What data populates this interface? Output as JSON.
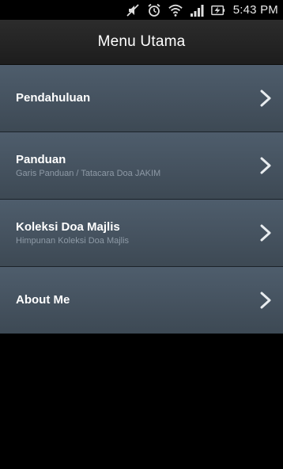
{
  "status_bar": {
    "time": "5:43 PM",
    "icons": [
      "mute-icon",
      "alarm-icon",
      "wifi-icon",
      "signal-icon",
      "battery-charging-icon"
    ]
  },
  "header": {
    "title": "Menu Utama"
  },
  "menu": {
    "items": [
      {
        "label": "Pendahuluan",
        "sublabel": ""
      },
      {
        "label": "Panduan",
        "sublabel": "Garis Panduan / Tatacara Doa JAKIM"
      },
      {
        "label": "Koleksi Doa Majlis",
        "sublabel": "Himpunan Koleksi Doa Majlis"
      },
      {
        "label": "About Me",
        "sublabel": ""
      }
    ]
  },
  "colors": {
    "item_background": "#46535f",
    "title_bar": "#262626",
    "sublabel": "#8e9aa6"
  }
}
